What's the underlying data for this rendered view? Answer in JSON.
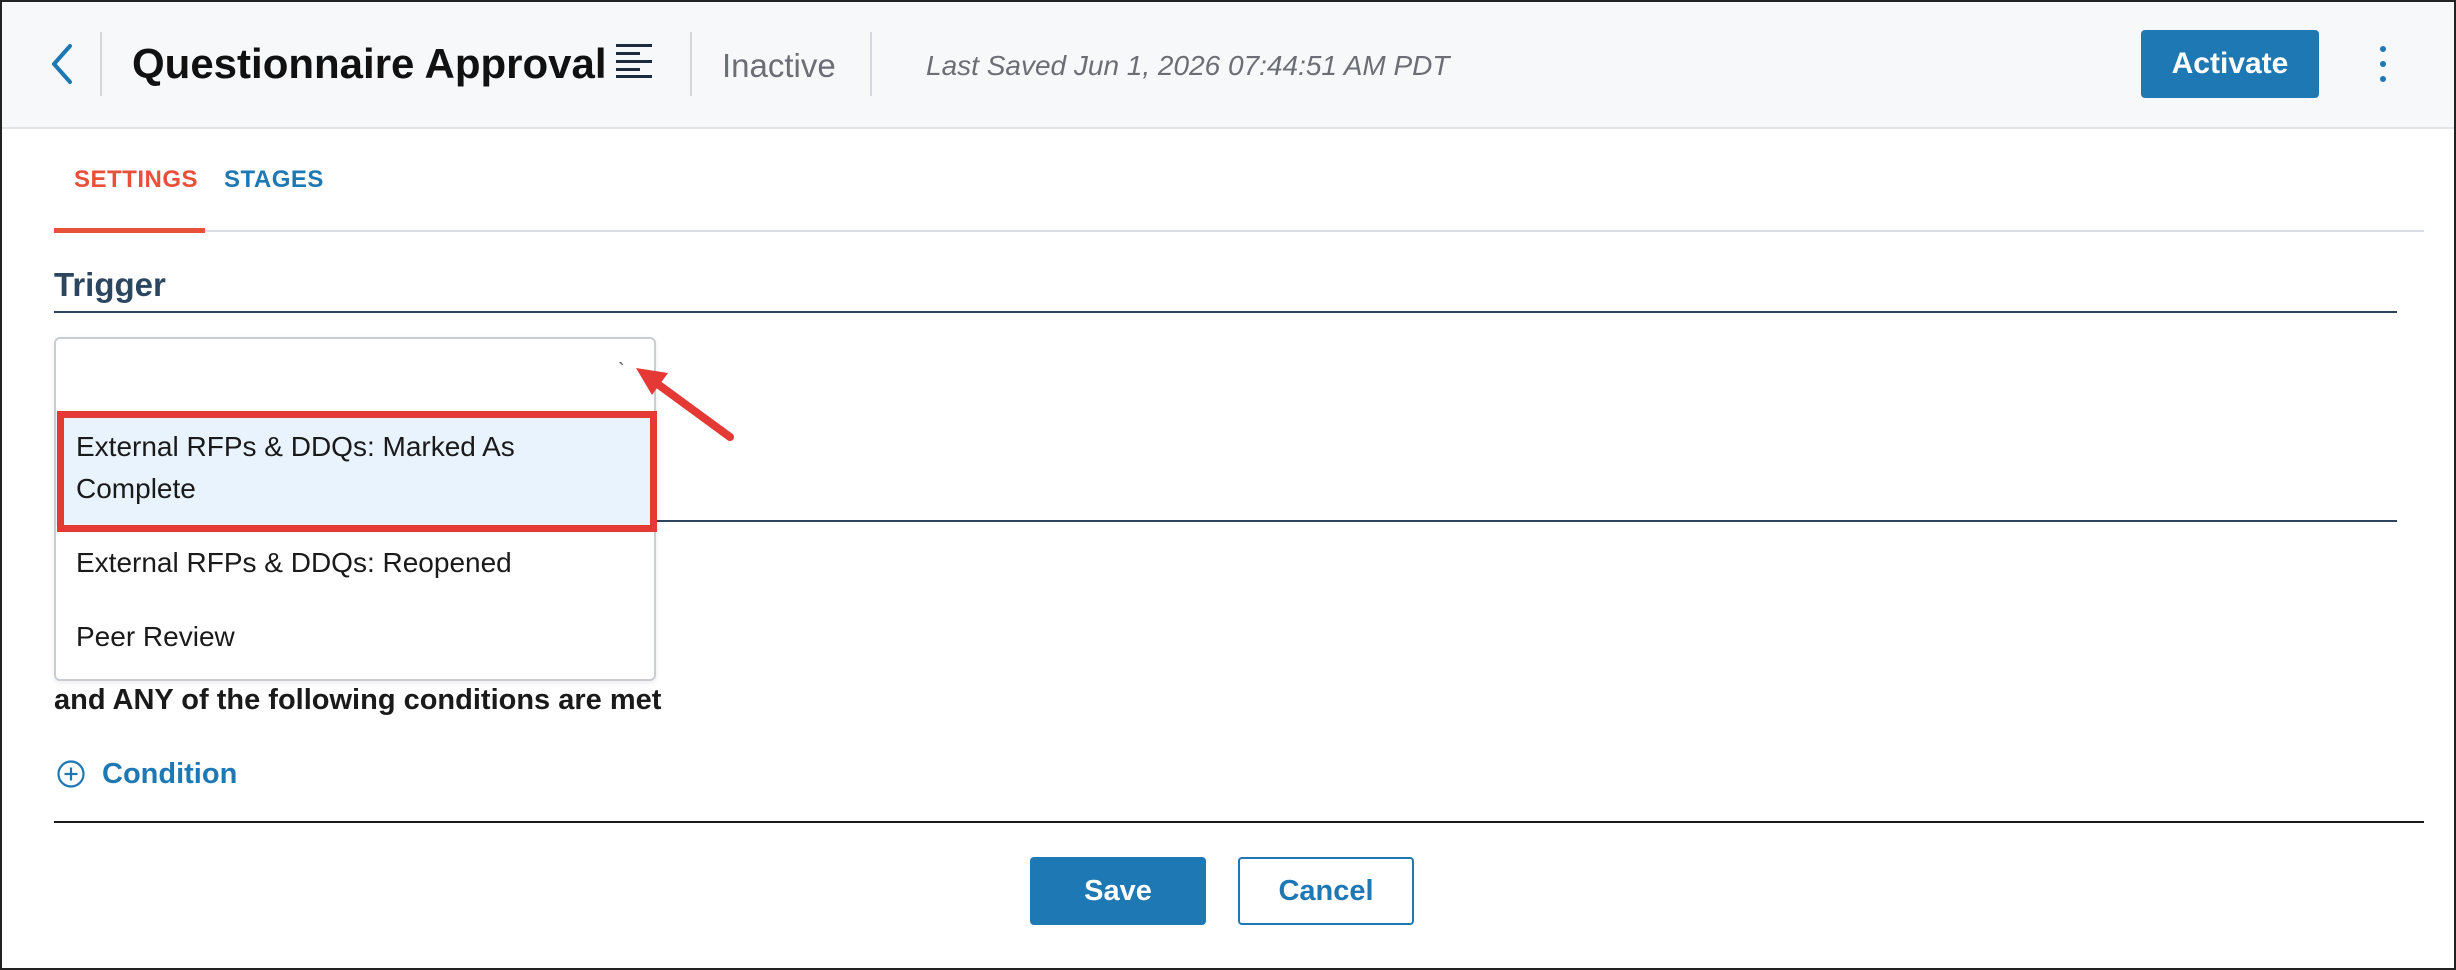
{
  "header": {
    "title": "Questionnaire Approval",
    "status": "Inactive",
    "last_saved": "Last Saved Jun 1, 2026 07:44:51 AM PDT",
    "activate_label": "Activate"
  },
  "tabs": [
    {
      "label": "SETTINGS",
      "active": true
    },
    {
      "label": "STAGES",
      "active": false
    }
  ],
  "trigger": {
    "section_title": "Trigger",
    "selected_value": "",
    "options": [
      {
        "label_line1": "External RFPs & DDQs: Marked As",
        "label_line2": "Complete",
        "highlighted": true
      },
      {
        "label": "External RFPs & DDQs: Reopened"
      },
      {
        "label": "Peer Review"
      }
    ]
  },
  "conditions": {
    "text": "and ANY of the following conditions are met",
    "add_label": "Condition"
  },
  "footer": {
    "save_label": "Save",
    "cancel_label": "Cancel"
  },
  "colors": {
    "primary": "#1e78b4",
    "active_tab": "#e8503a",
    "annotation_red": "#e53935",
    "highlight_bg": "#e8f3fd"
  }
}
